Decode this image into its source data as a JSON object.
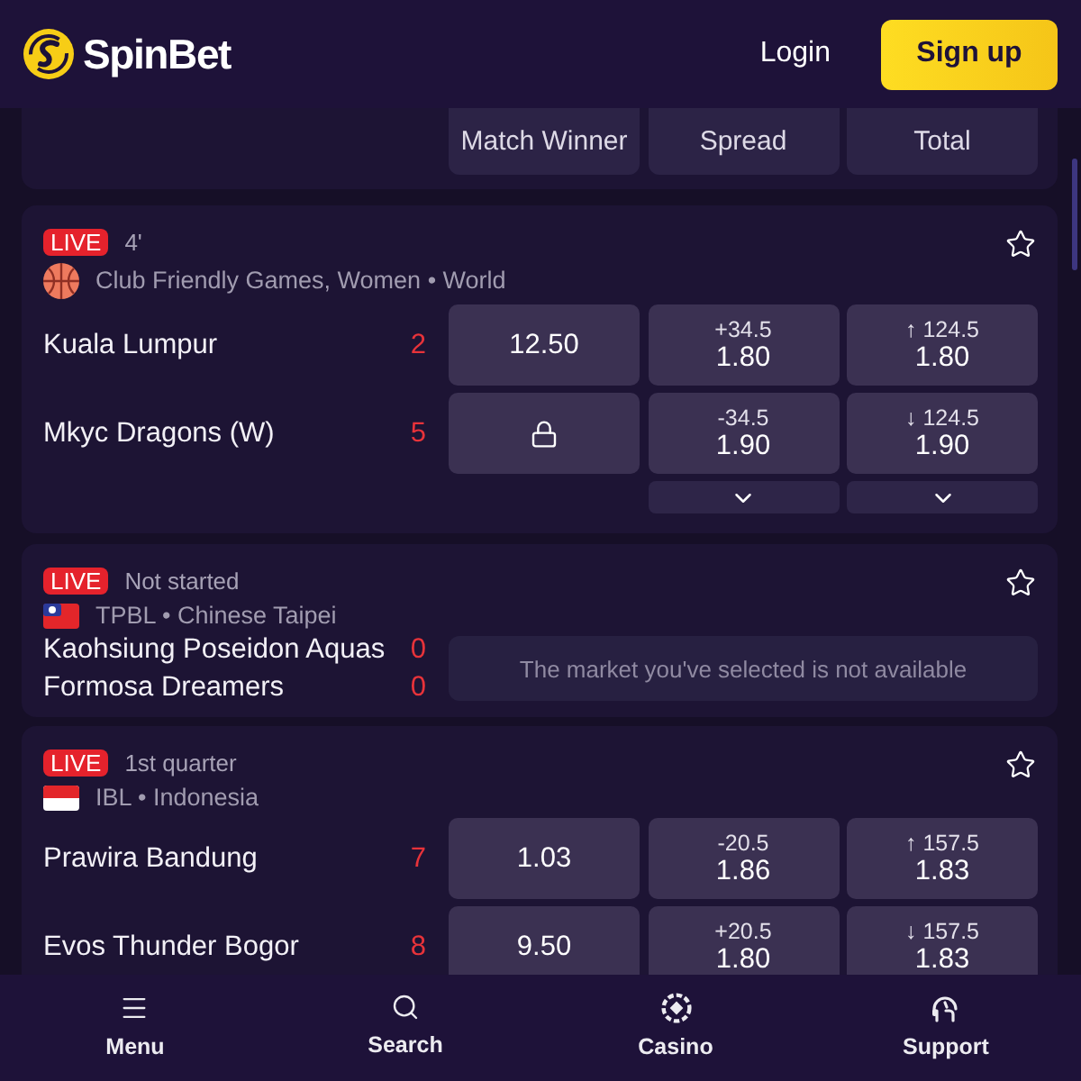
{
  "header": {
    "logo": "SpinBet",
    "login": "Login",
    "signup": "Sign up"
  },
  "market_columns": [
    "Match Winner",
    "Spread",
    "Total"
  ],
  "events": [
    {
      "status": "LIVE",
      "clock": "4'",
      "favorite": false,
      "league": {
        "kind": "basketball",
        "name": "Club Friendly Games, Women • World"
      },
      "teams": [
        {
          "name": "Kuala Lumpur",
          "score": "2",
          "odds": [
            {
              "kind": "odds",
              "price": "12.50"
            },
            {
              "kind": "odds",
              "line": "+34.5",
              "price": "1.80"
            },
            {
              "kind": "odds",
              "line": "↑ 124.5",
              "price": "1.80"
            }
          ]
        },
        {
          "name": "Mkyc Dragons (W)",
          "score": "5",
          "odds": [
            {
              "kind": "locked"
            },
            {
              "kind": "odds",
              "line": "-34.5",
              "price": "1.90"
            },
            {
              "kind": "odds",
              "line": "↓ 124.5",
              "price": "1.90"
            }
          ]
        }
      ],
      "more": [
        {
          "kind": "blank"
        },
        {
          "kind": "chevron"
        },
        {
          "kind": "chevron"
        }
      ]
    },
    {
      "status": "LIVE",
      "clock": "Not started",
      "favorite": false,
      "league": {
        "kind": "taiwan_flag",
        "name": "TPBL • Chinese Taipei"
      },
      "teams": [
        {
          "name": "Kaohsiung Poseidon Aquas",
          "score": "0"
        },
        {
          "name": "Formosa Dreamers",
          "score": "0"
        }
      ],
      "notice": "The market you've selected is not available"
    },
    {
      "status": "LIVE",
      "clock": "1st quarter",
      "favorite": false,
      "league": {
        "kind": "indonesia_flag",
        "name": "IBL • Indonesia"
      },
      "teams": [
        {
          "name": "Prawira Bandung",
          "score": "7",
          "odds": [
            {
              "kind": "odds",
              "price": "1.03"
            },
            {
              "kind": "odds",
              "line": "-20.5",
              "price": "1.86"
            },
            {
              "kind": "odds",
              "line": "↑ 157.5",
              "price": "1.83"
            }
          ]
        },
        {
          "name": "Evos Thunder Bogor",
          "score": "8",
          "odds": [
            {
              "kind": "odds",
              "price": "9.50"
            },
            {
              "kind": "odds",
              "line": "+20.5",
              "price": "1.80"
            },
            {
              "kind": "odds",
              "line": "↓ 157.5",
              "price": "1.83"
            }
          ]
        }
      ]
    }
  ],
  "nav": [
    {
      "kind": "menu",
      "label": "Menu"
    },
    {
      "kind": "search",
      "label": "Search"
    },
    {
      "kind": "casino",
      "label": "Casino"
    },
    {
      "kind": "support",
      "label": "Support"
    }
  ]
}
